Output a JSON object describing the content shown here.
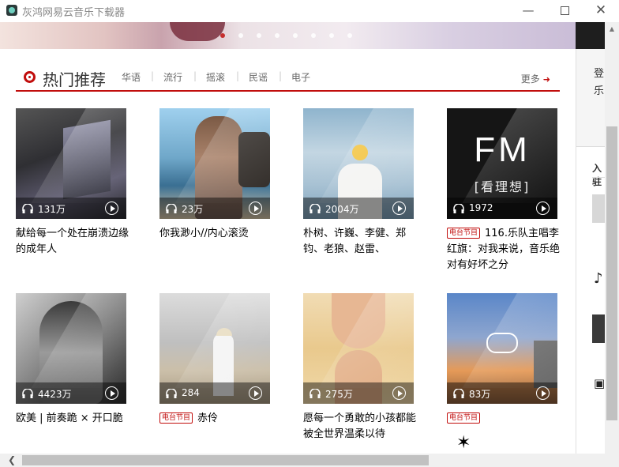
{
  "window": {
    "title": "灰鸿网易云音乐下载器",
    "minimize_glyph": "—",
    "close_glyph": "✕"
  },
  "banner": {
    "dot_count": 8,
    "active_dot_index": 0
  },
  "right_panel": {
    "login_line1": "登",
    "login_line2": "乐",
    "section_label": "入驻"
  },
  "section": {
    "title": "热门推荐",
    "tags": [
      "华语",
      "流行",
      "摇滚",
      "民谣",
      "电子"
    ],
    "more_label": "更多",
    "more_arrow_glyph": "➜"
  },
  "radio_tag_label": "电台节目",
  "cards": [
    {
      "play_count": "131万",
      "title": "献给每一个处在崩溃边缘的成年人",
      "radio": false
    },
    {
      "play_count": "23万",
      "title": "你我渺小//内心滚烫",
      "radio": false
    },
    {
      "play_count": "2004万",
      "title": "朴树、许巍、李健、郑钧、老狼、赵雷、",
      "radio": false
    },
    {
      "play_count": "1972",
      "title": "116.乐队主唱李红旗：对我来说，音乐绝对有好坏之分",
      "radio": true,
      "cover_text": "FM",
      "cover_subtext": "[看理想]"
    },
    {
      "play_count": "4423万",
      "title": "欧美 | 前奏跪 × 开口脆",
      "radio": false
    },
    {
      "play_count": "284",
      "title": "赤伶",
      "radio": true
    },
    {
      "play_count": "275万",
      "title": "愿每一个勇敢的小孩都能被全世界温柔以待",
      "radio": false
    },
    {
      "play_count": "83万",
      "title": "",
      "radio": true
    }
  ],
  "colors": {
    "accent": "#c10d0c",
    "text": "#333333",
    "muted": "#666666"
  },
  "icons": {
    "headphone": "headphone-icon",
    "play": "play-icon",
    "section": "record-icon",
    "more": "arrow-right-icon"
  }
}
